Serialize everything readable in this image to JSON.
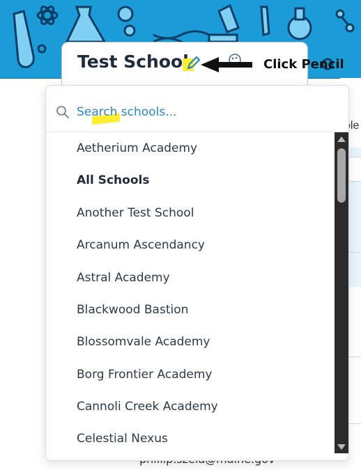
{
  "header": {
    "school_name": "Test School",
    "callout": "Click Pencil"
  },
  "search": {
    "placeholder": "Search schools..."
  },
  "schools": [
    {
      "label": "Aetherium Academy",
      "bold": false
    },
    {
      "label": "All Schools",
      "bold": true
    },
    {
      "label": "Another Test School",
      "bold": false
    },
    {
      "label": "Arcanum Ascendancy",
      "bold": false
    },
    {
      "label": "Astral Academy",
      "bold": false
    },
    {
      "label": "Blackwood Bastion",
      "bold": false
    },
    {
      "label": "Blossomvale Academy",
      "bold": false
    },
    {
      "label": "Borg Frontier Academy",
      "bold": false
    },
    {
      "label": "Cannoli Creek Academy",
      "bold": false
    },
    {
      "label": "Celestial Nexus",
      "bold": false
    }
  ],
  "background": {
    "partial_text": "ole",
    "email": "phillip.szela@maine.gov"
  },
  "colors": {
    "banner": "#1b9bd7",
    "highlight": "#ffee33",
    "link_text": "#1a7fc1"
  }
}
